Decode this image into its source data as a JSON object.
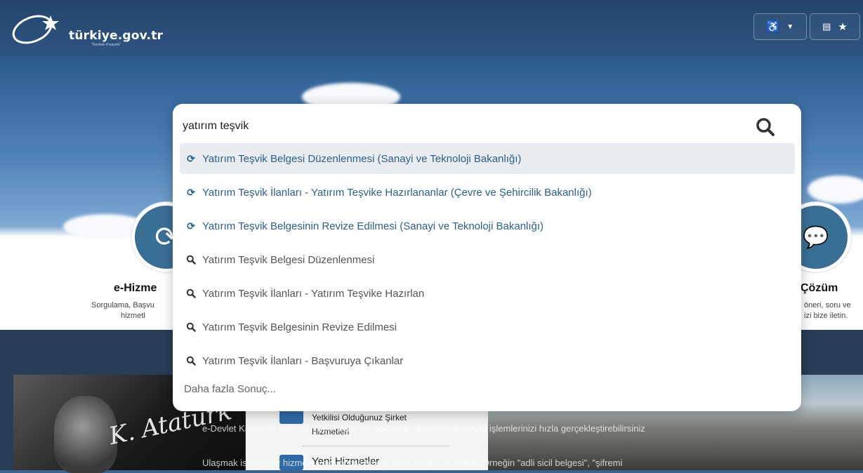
{
  "header": {
    "logo_text": "türkiye.gov.tr",
    "logo_subtext": "\"Devletin Kısayolu\"",
    "accessibility_icon": "wheelchair-icon",
    "favorites_icon": "star-icon"
  },
  "search": {
    "query": "yatırım teşvik",
    "suggestions": [
      {
        "label": "Yatırım Teşvik Belgesi Düzenlenmesi (Sanayi ve Teknoloji Bakanlığı)",
        "kind": "service",
        "active": true
      },
      {
        "label": "Yatırım Teşvik İlanları - Yatırım Teşvike Hazırlananlar (Çevre ve Şehircilik Bakanlığı)",
        "kind": "service",
        "active": false
      },
      {
        "label": "Yatırım Teşvik Belgesinin Revize Edilmesi (Sanayi ve Teknoloji Bakanlığı)",
        "kind": "service",
        "active": false
      },
      {
        "label": "Yatırım Teşvik Belgesi Düzenlenmesi",
        "kind": "search",
        "active": false
      },
      {
        "label": "Yatırım Teşvik İlanları - Yatırım Teşvike Hazırlan",
        "kind": "search",
        "active": false
      },
      {
        "label": "Yatırım Teşvik Belgesinin Revize Edilmesi",
        "kind": "search",
        "active": false
      },
      {
        "label": "Yatırım Teşvik İlanları - Başvuruya Çıkanlar",
        "kind": "search",
        "active": false
      }
    ],
    "more_label": "Daha fazla Sonuç..."
  },
  "services": {
    "left_title": "e-Hizme",
    "left_desc_1": "Sorgulama, Başvu",
    "left_desc_2": "hizmetl",
    "right_title": "Çözüm",
    "right_desc_1": "öneri, soru ve",
    "right_desc_2": "izi bize iletin."
  },
  "lower": {
    "signature": "K. Atatürk",
    "panel_item_1": "Yetkilisi Olduğunuz Şirket",
    "panel_item_1b": "Hizmetleri",
    "panel_item_2": "Yeni Hizmetler",
    "overlay_line_1": "e-Devlet Kapısı ile bilgi edinmelerinize tek noktadan ulaşabilir, başvuru işlemlerinizi hızla gerçekleştirebilirsiniz",
    "overlay_line_2": "Ulaşmak istediğiniz hizmete veya bilgiyi birkaç basit kelime ile aratın. Örneğin \"adli sicil belgesi\", \"şifremi"
  }
}
